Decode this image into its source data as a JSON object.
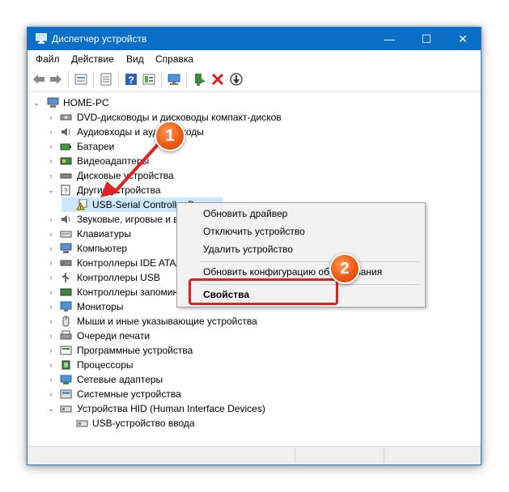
{
  "window": {
    "title": "Диспетчер устройств",
    "controls": {
      "minimize": "—",
      "maximize": "☐",
      "close": "✕"
    }
  },
  "menu": [
    "Файл",
    "Действие",
    "Вид",
    "Справка"
  ],
  "toolbar": {
    "buttons": [
      "back-icon",
      "forward-icon",
      "properties-view-icon",
      "list-icon",
      "help-icon",
      "details-icon",
      "monitor-icon",
      "update-driver-icon",
      "uninstall-icon",
      "download-icon"
    ]
  },
  "tree": {
    "root": "HOME-PC",
    "items": [
      "DVD-дисководы и дисководы компакт-дисков",
      "Аудиовходы и аудиовыходы",
      "Батареи",
      "Видеоадаптеры",
      "Дисковые устройства",
      "Другие устройства",
      "USB-Serial Controller D",
      "Звуковые, игровые и видеоустройства",
      "Клавиатуры",
      "Компьютер",
      "Контроллеры IDE ATA/ATAPI",
      "Контроллеры USB",
      "Контроллеры запоминающих устройств",
      "Мониторы",
      "Мыши и иные указывающие устройства",
      "Очереди печати",
      "Программные устройства",
      "Процессоры",
      "Сетевые адаптеры",
      "Системные устройства",
      "Устройства HID (Human Interface Devices)",
      "USB-устройство ввода"
    ]
  },
  "context_menu": {
    "items": [
      "Обновить драйвер",
      "Отключить устройство",
      "Удалить устройство",
      "Обновить конфигурацию оборудования",
      "Свойства"
    ]
  },
  "annotations": {
    "badge1": "1",
    "badge2": "2"
  },
  "colors": {
    "titlebar": "#0b6fc8",
    "accent_red": "#e02121",
    "badge_orange": "#f05a12"
  }
}
